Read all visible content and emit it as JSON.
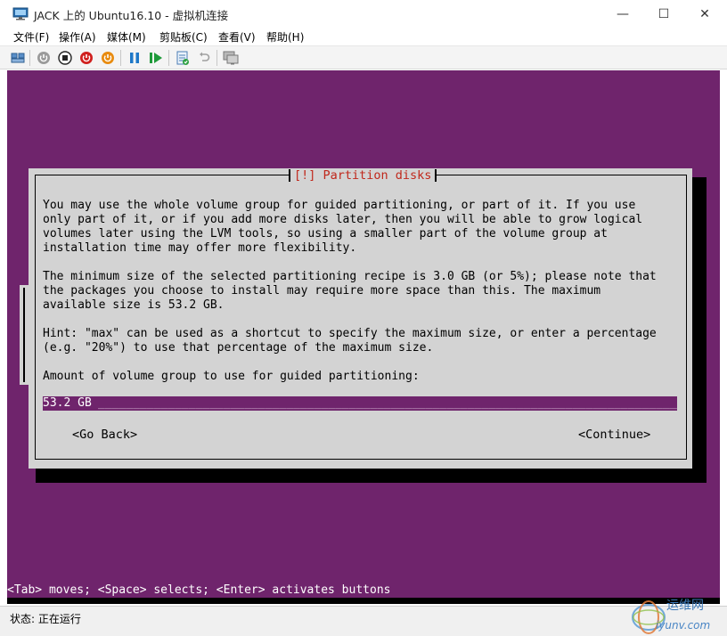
{
  "window": {
    "title": "JACK 上的 Ubuntu16.10 - 虚拟机连接",
    "minimize_glyph": "—",
    "maximize_glyph": "☐",
    "close_glyph": "✕"
  },
  "menu": {
    "items": [
      "文件(F)",
      "操作(A)",
      "媒体(M)",
      "剪贴板(C)",
      "查看(V)",
      "帮助(H)"
    ]
  },
  "toolbar": {
    "icons": [
      "ctrl-alt-del-icon",
      "start-icon",
      "turn-off-icon",
      "shutdown-icon",
      "save-state-icon",
      "pause-icon",
      "resume-icon",
      "checkpoint-icon",
      "revert-icon",
      "enhanced-session-icon"
    ]
  },
  "installer": {
    "dialog_title": "[!] Partition disks",
    "paragraph1": [
      "You may use the whole volume group for guided partitioning, or part of it. If you use",
      "only part of it, or if you add more disks later, then you will be able to grow logical",
      "volumes later using the LVM tools, so using a smaller part of the volume group at",
      "installation time may offer more flexibility."
    ],
    "paragraph2": [
      "The minimum size of the selected partitioning recipe is 3.0 GB (or 5%); please note that",
      "the packages you choose to install may require more space than this. The maximum",
      "available size is 53.2 GB."
    ],
    "paragraph3": [
      "Hint: \"max\" can be used as a shortcut to specify the maximum size, or enter a percentage",
      "(e.g. \"20%\") to use that percentage of the maximum size."
    ],
    "prompt": "Amount of volume group to use for guided partitioning:",
    "input_value": "53.2 GB",
    "input_fill": "_____________________________________________________________________________________________",
    "go_back_label": "<Go Back>",
    "continue_label": "<Continue>",
    "help_line": "<Tab> moves; <Space> selects; <Enter> activates buttons"
  },
  "status": {
    "text": "状态: 正在运行"
  },
  "watermark": {
    "text": "运维网",
    "subtext": "iyunv.com"
  },
  "colors": {
    "vm_background": "#6f246c",
    "dialog_background": "#d3d3d3",
    "dialog_title": "#c0281c"
  }
}
